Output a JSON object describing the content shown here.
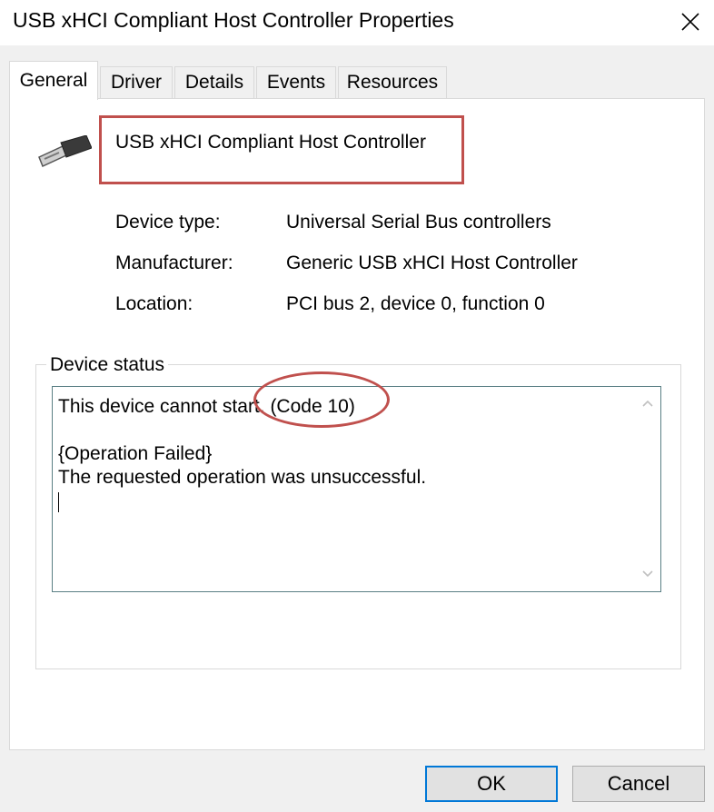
{
  "window": {
    "title": "USB xHCI Compliant Host Controller Properties"
  },
  "tabs": [
    {
      "label": "General",
      "active": true
    },
    {
      "label": "Driver",
      "active": false
    },
    {
      "label": "Details",
      "active": false
    },
    {
      "label": "Events",
      "active": false
    },
    {
      "label": "Resources",
      "active": false
    }
  ],
  "device": {
    "icon": "usb-connector-icon",
    "name": "USB xHCI Compliant Host Controller",
    "properties": [
      {
        "label": "Device type:",
        "value": "Universal Serial Bus controllers"
      },
      {
        "label": "Manufacturer:",
        "value": "Generic USB xHCI Host Controller"
      },
      {
        "label": "Location:",
        "value": "PCI bus 2, device 0, function 0"
      }
    ]
  },
  "status": {
    "legend": "Device status",
    "lines": [
      "This device cannot start. (Code 10)",
      "",
      "{Operation Failed}",
      "The requested operation was unsuccessful."
    ]
  },
  "buttons": {
    "ok": "OK",
    "cancel": "Cancel"
  },
  "colors": {
    "highlight": "#c0504d",
    "default_button_border": "#0078d7"
  }
}
